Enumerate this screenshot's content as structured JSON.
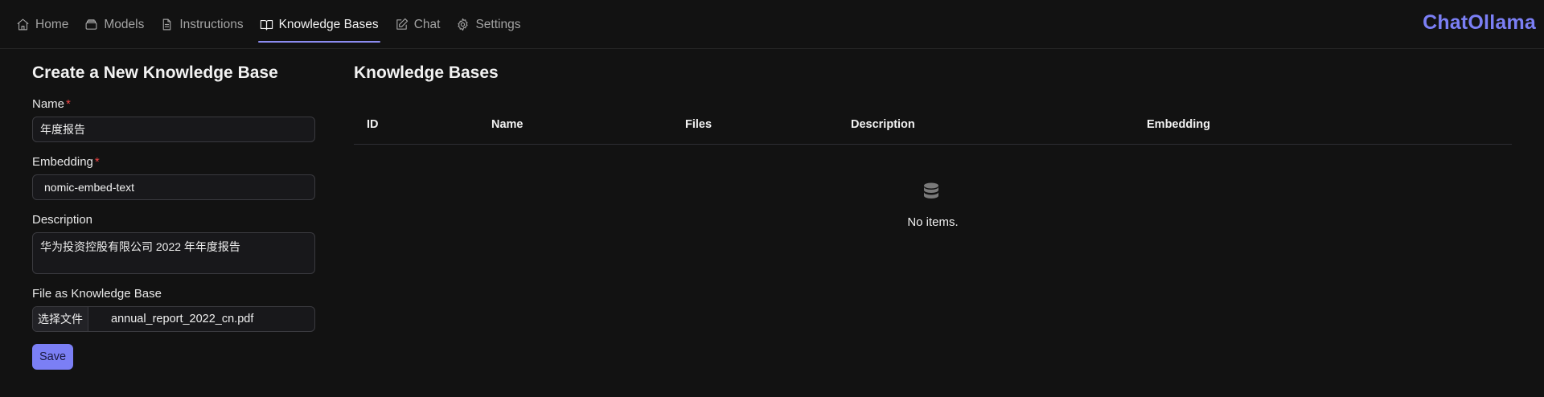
{
  "nav": {
    "items": [
      {
        "label": "Home",
        "icon": "home-icon"
      },
      {
        "label": "Models",
        "icon": "models-icon"
      },
      {
        "label": "Instructions",
        "icon": "document-icon"
      },
      {
        "label": "Knowledge Bases",
        "icon": "book-open-icon",
        "active": true
      },
      {
        "label": "Chat",
        "icon": "pencil-square-icon"
      },
      {
        "label": "Settings",
        "icon": "gear-icon"
      }
    ],
    "brand": "ChatOllama"
  },
  "form": {
    "title": "Create a New Knowledge Base",
    "name_label": "Name",
    "name_value": "年度报告",
    "embedding_label": "Embedding",
    "embedding_value": "nomic-embed-text",
    "description_label": "Description",
    "description_value": "华为投资控股有限公司 2022 年年度报告",
    "file_label": "File as Knowledge Base",
    "file_button": "选择文件",
    "file_name": "annual_report_2022_cn.pdf",
    "save_label": "Save",
    "required_mark": "*"
  },
  "table": {
    "title": "Knowledge Bases",
    "columns": [
      "ID",
      "Name",
      "Files",
      "Description",
      "Embedding"
    ],
    "rows": [],
    "empty_text": "No items.",
    "empty_icon": "database-icon"
  },
  "colors": {
    "background": "#121212",
    "accent": "#7b7ff5",
    "required": "#ef4444"
  }
}
